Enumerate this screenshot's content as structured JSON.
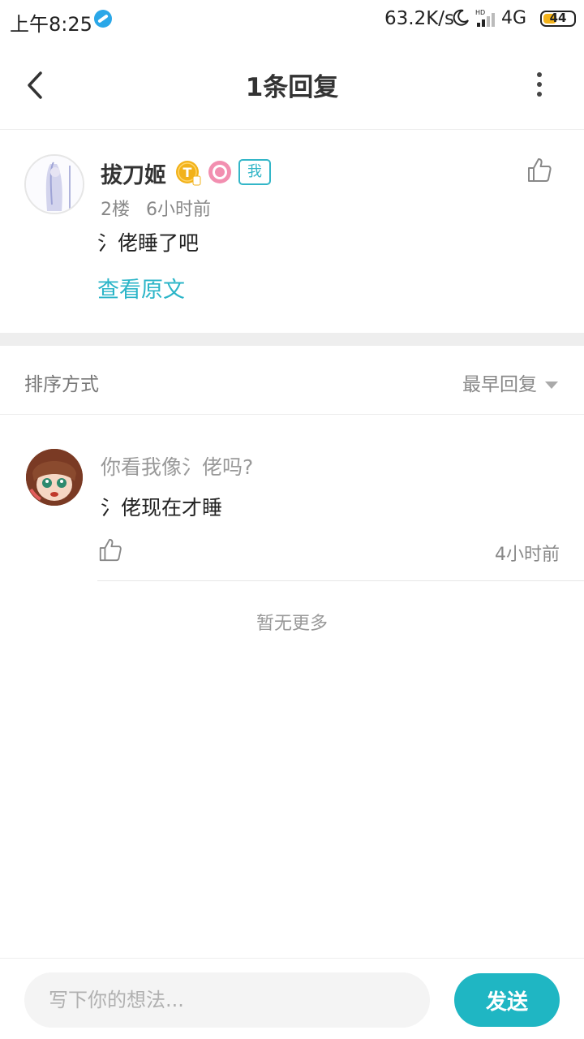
{
  "status_bar": {
    "time": "上午8:25",
    "net_speed": "63.2K/s",
    "network_type": "4G",
    "battery": "44"
  },
  "header": {
    "title": "1条回复"
  },
  "post": {
    "username": "拔刀姬",
    "badge_me": "我",
    "floor": "2楼",
    "time": "6小时前",
    "content": "氵佬睡了吧",
    "view_original": "查看原文"
  },
  "sort": {
    "label": "排序方式",
    "selected": "最早回复"
  },
  "reply": {
    "quote": "你看我像氵佬吗?",
    "text": "氵佬现在才睡",
    "time": "4小时前"
  },
  "list_footer": "暂无更多",
  "bottom_bar": {
    "input_placeholder": "写下你的想法...",
    "send_label": "发送"
  },
  "colors": {
    "accent": "#1fb6c3",
    "link": "#2bb5c8",
    "badge_gold": "#f2b21a",
    "badge_pink": "#f28fb0"
  }
}
